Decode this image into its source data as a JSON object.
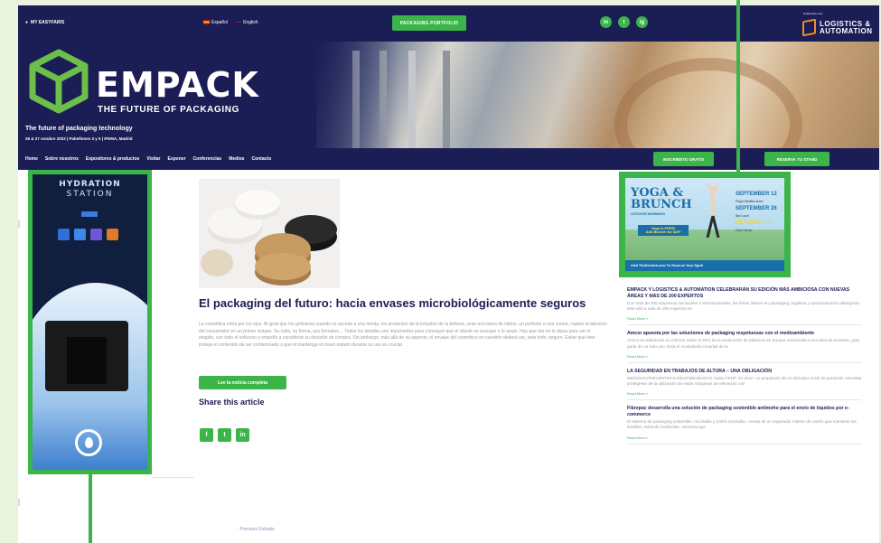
{
  "topbar": {
    "my_label": "MY EASYFAIRS",
    "lang_es": "Español",
    "lang_en": "English",
    "portfolio_label": "PACKAGING PORTFOLIO",
    "social": [
      "in",
      "t",
      "ig"
    ],
    "colocated": "Celebrado con:",
    "logo_line1": "LOGISTICS &",
    "logo_line2": "AUTOMATION"
  },
  "hero": {
    "logo_text": "EMPACK",
    "logo_sub": "THE FUTURE OF PACKAGING",
    "tagline": "The future of packaging technology",
    "dates": "26 & 27 octubre 2022 | Pabellones 3 y 5 | IFEMA, Madrid"
  },
  "nav": {
    "links": [
      "Home",
      "Sobre nosotros",
      "Expositores & productos",
      "Visitar",
      "Exponer",
      "Conferencias",
      "Medios",
      "Contacto"
    ],
    "btn_contact": "INSCRÍBETE GRATIS",
    "btn_stand": "RESERVA TU STAND"
  },
  "left_ad": {
    "title": "HYDRATION",
    "subtitle": "STATION"
  },
  "article": {
    "title": "El packaging del futuro: hacia envases microbiológicamente seguros",
    "body": "La cosmética entra por los ojos. Al igual que las golosinas cuando se accede a una tienda, los productos de la industria de la belleza, sean una barra de labios, un perfume o una crema, captan la atención del consumidor en un primer vistazo. Su color, su forma, sus formatos… Todos los detalles son importantes para conseguir que el cliente se acerque o lo anule. Hay que dar en la diana para ser el elegido, con todo el esfuerzo y empeño a considerar su decisión de compra. Sin embargo, más allá de su aspecto, el envase del cosmético en cuestión deberá ser, ante todo, seguro. Evitar que éste proteja el contenido de ser contaminado o que el mantenga en buen estado durante su uso es crucial.",
    "read_more": "Lee la noticia completa",
    "share_title": "Share this article",
    "share_icons": [
      "f",
      "t",
      "in"
    ],
    "prev": "← Previous Entrada"
  },
  "right_ad": {
    "title_1": "YOGA &",
    "title_2": "BRUNCH",
    "sub": "OUTDOOR MORNINGS",
    "free_1": "Yoga is FREE!",
    "free_2": "Add Brunch for $25*",
    "d1": "SEPTEMBER 12",
    "s1": "Playa Mediterránea",
    "d2": "SEPTEMBER 26",
    "s2": "Bar Louie",
    "d3": "OCTOBER 10",
    "s3": "Club Ocean",
    "foot": "Visit TheDeretch.com To Reserve Your Spot!"
  },
  "news": [
    {
      "title": "EMPACK Y LOGISTICS & AUTOMATION CELEBRARÁN SU EDICIÓN MÁS AMBICIOSA CON NUEVAS ÁREAS Y MÁS DE 200 EXPERTOS",
      "excerpt": "Con más de 400 empresas nacionales e internacionales, las ferias líderes en packaging, logística y automatización albergarán este año a más de 200 expertos en",
      "more": "Read More »"
    },
    {
      "title": "Amcor apuesta por las soluciones de packaging respetuosas con el medioambiente",
      "excerpt": "Amcor ha elaborado un informe sobre el 40% de la producción de plásticos en Europa consumida a circuitos de envases, gran parte de un solo uso. Está el movimiento mundial de la",
      "more": "Read More »"
    },
    {
      "title": "LA SEGURIDAD EN TRABAJOS DE ALTURA – UNA OBLIGACIÓN",
      "excerpt": "MEDIDAS PREVENTIVAS RECOMENDADAS Sabia FEHP. Es decir: un preparado de un elevador móvil de personal, necesitar protegerse de la utilización de estas máquinas de elevación con",
      "more": "Read More »"
    },
    {
      "title": "Fibrepac desarrolla una solución de packaging sostenible antimoho para el envío de líquidos por e-commerce",
      "excerpt": "El sistema de packaging sostenible, reciclable y 100% reciclable, consta de un separador interior de cartón que mantiene las botellas, evitando incidentes, mientras que",
      "more": "Read More »"
    }
  ],
  "colors": {
    "navy": "#1b1d55",
    "green": "#3bb44a"
  }
}
